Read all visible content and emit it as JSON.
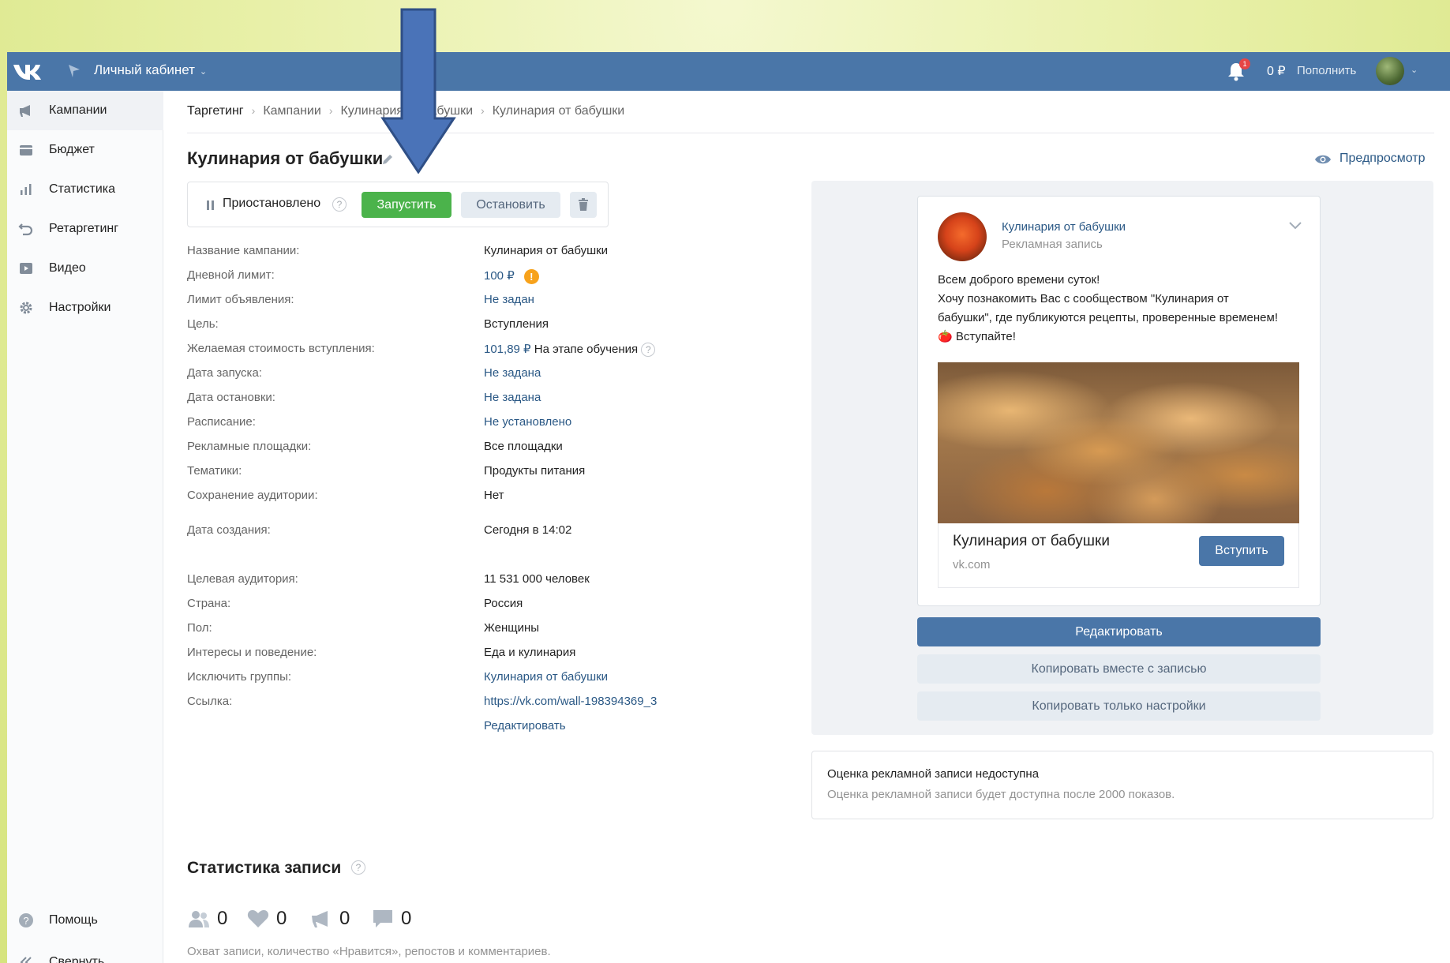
{
  "topbar": {
    "cabinet_label": "Личный кабинет",
    "balance": "0 ₽",
    "topup_label": "Пополнить",
    "notifications_count": "1"
  },
  "sidebar": {
    "items": [
      {
        "label": "Кампании",
        "icon": "megaphone-icon"
      },
      {
        "label": "Бюджет",
        "icon": "wallet-icon"
      },
      {
        "label": "Статистика",
        "icon": "bar-chart-icon"
      },
      {
        "label": "Ретаргетинг",
        "icon": "retarget-icon"
      },
      {
        "label": "Видео",
        "icon": "video-icon"
      },
      {
        "label": "Настройки",
        "icon": "gear-icon"
      }
    ],
    "help_label": "Помощь",
    "collapse_label": "Свернуть"
  },
  "breadcrumb": [
    "Таргетинг",
    "Кампании",
    "Кулинария от бабушки",
    "Кулинария от бабушки"
  ],
  "page_title": "Кулинария от бабушки",
  "preview_label": "Предпросмотр",
  "status": {
    "text": "Приостановлено",
    "start_label": "Запустить",
    "stop_label": "Остановить"
  },
  "props": [
    {
      "key": "Название кампании:",
      "value": "Кулинария от бабушки"
    },
    {
      "key": "Дневной лимит:",
      "value": "100 ₽"
    },
    {
      "key": "Лимит объявления:",
      "value": "Не задан"
    },
    {
      "key": "Цель:",
      "value": "Вступления"
    },
    {
      "key": "Желаемая стоимость вступления:",
      "value": "101,89 ₽",
      "extra": "На этапе обучения"
    },
    {
      "key": "Дата запуска:",
      "value": "Не задана"
    },
    {
      "key": "Дата остановки:",
      "value": "Не задана"
    },
    {
      "key": "Расписание:",
      "value": "Не установлено"
    },
    {
      "key": "Рекламные площадки:",
      "value": "Все площадки"
    },
    {
      "key": "Тематики:",
      "value": "Продукты питания"
    },
    {
      "key": "Сохранение аудитории:",
      "value": "Нет"
    },
    {
      "key": "Дата создания:",
      "value": "Сегодня в 14:02"
    },
    {
      "key": "Целевая аудитория:",
      "value": "11 531 000 человек"
    },
    {
      "key": "Страна:",
      "value": "Россия"
    },
    {
      "key": "Пол:",
      "value": "Женщины"
    },
    {
      "key": "Интересы и поведение:",
      "value": "Еда и кулинария"
    },
    {
      "key": "Исключить группы:",
      "value": "Кулинария от бабушки"
    },
    {
      "key": "Ссылка:",
      "value": "https://vk.com/wall-198394369_3"
    }
  ],
  "edit_link": "Редактировать",
  "post": {
    "author": "Кулинария от бабушки",
    "subtitle": "Рекламная запись",
    "text_lines": [
      "Всем доброго времени суток!",
      "Хочу познакомить Вас с сообществом \"Кулинария от бабушки\", где публикуются рецепты, проверенные временем! 🍅 Вступайте!"
    ],
    "link_title": "Кулинария от бабушки",
    "link_domain": "vk.com",
    "join_label": "Вступить"
  },
  "actions": {
    "edit": "Редактировать",
    "copy_with_post": "Копировать вместе с записью",
    "copy_settings": "Копировать только настройки"
  },
  "rating": {
    "title": "Оценка рекламной записи недоступна",
    "subtitle": "Оценка рекламной записи будет доступна после 2000 показов."
  },
  "stats": {
    "title": "Статистика записи",
    "reach": "0",
    "likes": "0",
    "reposts": "0",
    "comments": "0",
    "caption": "Охват записи, количество «Нравится», репостов и комментариев."
  },
  "colors": {
    "brand": "#4a76a8",
    "start": "#4bb34b",
    "link": "#2a5885",
    "warning": "#f7a21b"
  }
}
